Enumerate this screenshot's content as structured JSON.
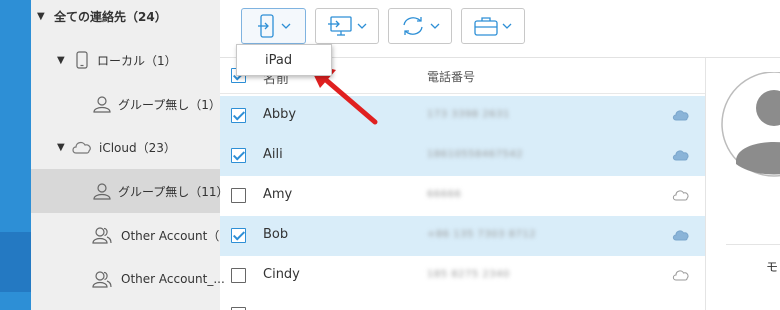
{
  "sidebar": {
    "all_contacts": "全ての連絡先（24）",
    "local": "ローカル（1）",
    "local_no_group": "グループ無し（1）",
    "icloud": "iCloud（23）",
    "icloud_no_group": "グループ無し（11）",
    "other_account_1": "Other Account（.",
    "other_account_2": "Other Account_..."
  },
  "dropdown": {
    "item": "iPad"
  },
  "list": {
    "header_name": "名前",
    "header_phone": "電話番号",
    "rows": [
      {
        "name": "Abby",
        "phone": "173 3398 2631",
        "checked": true,
        "synced": true
      },
      {
        "name": "Aili",
        "phone": "18610558467542",
        "checked": true,
        "synced": true
      },
      {
        "name": "Amy",
        "phone": "66666",
        "checked": false,
        "synced": false
      },
      {
        "name": "Bob",
        "phone": "+86 135 7303 8712",
        "checked": true,
        "synced": true
      },
      {
        "name": "Cindy",
        "phone": "185 8275 2340",
        "checked": false,
        "synced": false
      }
    ]
  },
  "detail": {
    "label_fragment": "モ"
  },
  "colors": {
    "accent": "#2d8fd6",
    "selected_row": "#d9edf9",
    "arrow": "#e02020"
  }
}
